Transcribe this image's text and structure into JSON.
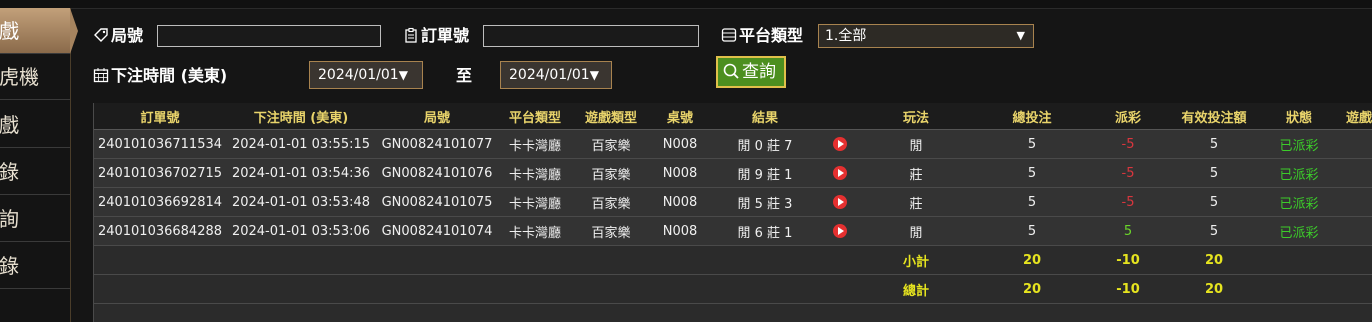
{
  "sidebar": {
    "items": [
      {
        "label": "戲",
        "active": true
      },
      {
        "label": "虎機"
      },
      {
        "label": "戲"
      },
      {
        "label": "錄"
      },
      {
        "label": "詢"
      },
      {
        "label": "錄"
      }
    ]
  },
  "filters": {
    "game_no_label": "局號",
    "game_no_value": "",
    "order_no_label": "訂單號",
    "order_no_value": "",
    "platform_label": "平台類型",
    "platform_value": "1.全部",
    "bet_time_label": "下注時間 (美東)",
    "date_from": "2024/01/01",
    "to_label": "至",
    "date_to": "2024/01/01",
    "query_label": "查詢"
  },
  "table": {
    "headers": [
      "訂單號",
      "下注時間 (美東)",
      "局號",
      "平台類型",
      "遊戲類型",
      "桌號",
      "結果",
      "",
      "玩法",
      "總投注",
      "派彩",
      "有效投注額",
      "狀態",
      "遊戲"
    ],
    "rows": [
      {
        "order": "240101036711534",
        "time": "2024-01-01 03:55:15",
        "game": "GN00824101077",
        "platform": "卡卡灣廳",
        "type": "百家樂",
        "table": "N008",
        "result": "閒 0 莊 7",
        "play": "閒",
        "bet": "5",
        "payout": "-5",
        "payout_sign": "neg",
        "valid": "5",
        "status": "已派彩"
      },
      {
        "order": "240101036702715",
        "time": "2024-01-01 03:54:36",
        "game": "GN00824101076",
        "platform": "卡卡灣廳",
        "type": "百家樂",
        "table": "N008",
        "result": "閒 9 莊 1",
        "play": "莊",
        "bet": "5",
        "payout": "-5",
        "payout_sign": "neg",
        "valid": "5",
        "status": "已派彩"
      },
      {
        "order": "240101036692814",
        "time": "2024-01-01 03:53:48",
        "game": "GN00824101075",
        "platform": "卡卡灣廳",
        "type": "百家樂",
        "table": "N008",
        "result": "閒 5 莊 3",
        "play": "莊",
        "bet": "5",
        "payout": "-5",
        "payout_sign": "neg",
        "valid": "5",
        "status": "已派彩"
      },
      {
        "order": "240101036684288",
        "time": "2024-01-01 03:53:06",
        "game": "GN00824101074",
        "platform": "卡卡灣廳",
        "type": "百家樂",
        "table": "N008",
        "result": "閒 6 莊 1",
        "play": "閒",
        "bet": "5",
        "payout": "5",
        "payout_sign": "pos",
        "valid": "5",
        "status": "已派彩"
      }
    ],
    "subtotal": {
      "label": "小計",
      "bet": "20",
      "payout": "-10",
      "valid": "20"
    },
    "total": {
      "label": "總計",
      "bet": "20",
      "payout": "-10",
      "valid": "20"
    }
  },
  "colors": {
    "accent": "#a8834f",
    "query_bg": "#4c8f1f",
    "header_text": "#e9d46b",
    "sum_text": "#e6e41f",
    "negative": "#d9363e",
    "positive": "#6bd62a",
    "status": "#3ccc2a"
  }
}
